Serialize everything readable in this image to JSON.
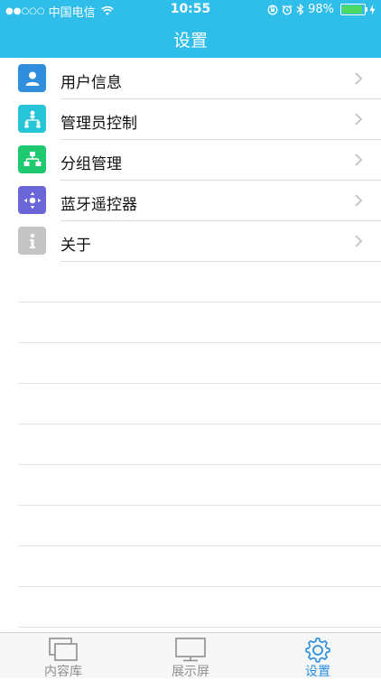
{
  "status_bar": {
    "signal_dots": "●●○○○",
    "carrier": "中国电信",
    "time": "10:55",
    "battery_percent": "98%",
    "battery_level": 0.98
  },
  "nav": {
    "title": "设置"
  },
  "settings": {
    "items": [
      {
        "label": "用户信息",
        "icon": "user-icon",
        "color": "#2f8fdc"
      },
      {
        "label": "管理员控制",
        "icon": "admin-hierarchy-icon",
        "color": "#27c5d8"
      },
      {
        "label": "分组管理",
        "icon": "group-icon",
        "color": "#1fc96f"
      },
      {
        "label": "蓝牙遥控器",
        "icon": "remote-control-icon",
        "color": "#6a66d8"
      },
      {
        "label": "关于",
        "icon": "info-icon",
        "color": "#c4c4c4"
      }
    ]
  },
  "tabbar": {
    "tabs": [
      {
        "label": "内容库",
        "icon": "content-library-icon",
        "active": false
      },
      {
        "label": "展示屏",
        "icon": "display-screen-icon",
        "active": false
      },
      {
        "label": "设置",
        "icon": "gear-icon",
        "active": true
      }
    ],
    "active_color": "#2b8fe0",
    "inactive_color": "#8e8e8e"
  },
  "colors": {
    "header": "#2fbde9"
  }
}
